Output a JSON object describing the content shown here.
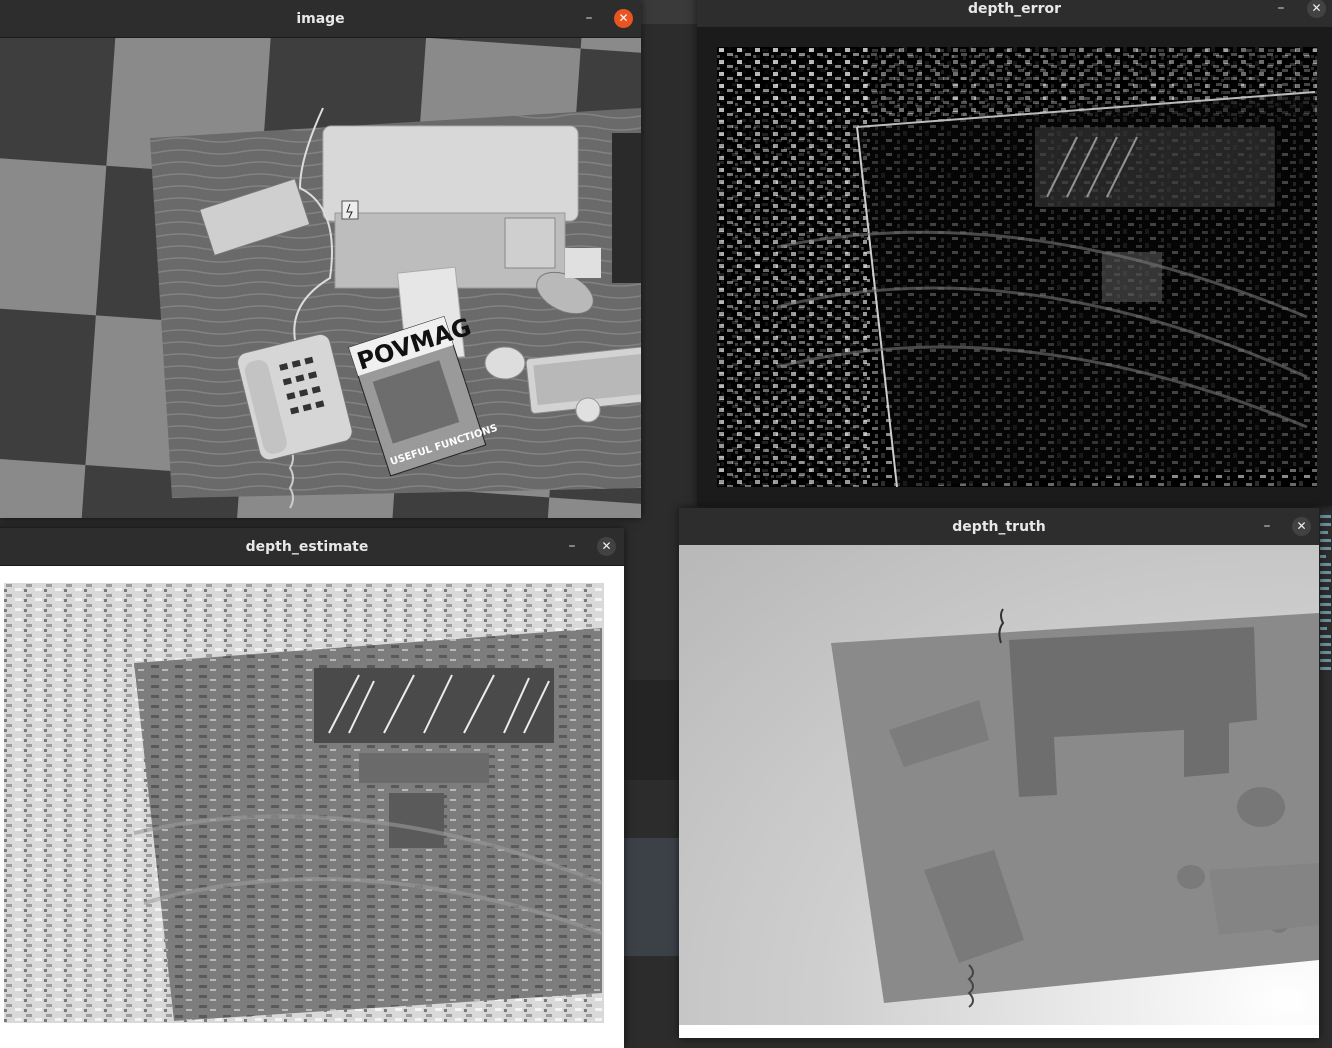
{
  "windows": {
    "image": {
      "title": "image",
      "minimize_glyph": "–",
      "close_glyph": "✕",
      "active": true
    },
    "depth_error": {
      "title": "depth_error",
      "minimize_glyph": "–",
      "close_glyph": "✕"
    },
    "depth_estimate": {
      "title": "depth_estimate",
      "minimize_glyph": "–",
      "close_glyph": "✕"
    },
    "depth_truth": {
      "title": "depth_truth",
      "minimize_glyph": "–",
      "close_glyph": "✕"
    }
  },
  "scene": {
    "magazine_masthead": "POVMAG",
    "magazine_footer": "USEFUL FUNCTIONS"
  },
  "colors": {
    "titlebar_bg": "#2d2d2d",
    "close_active": "#e95420",
    "close_inactive": "#424242",
    "desktop_bg": "#2c2c2c"
  },
  "icons": [
    "minimize-icon",
    "close-icon"
  ]
}
